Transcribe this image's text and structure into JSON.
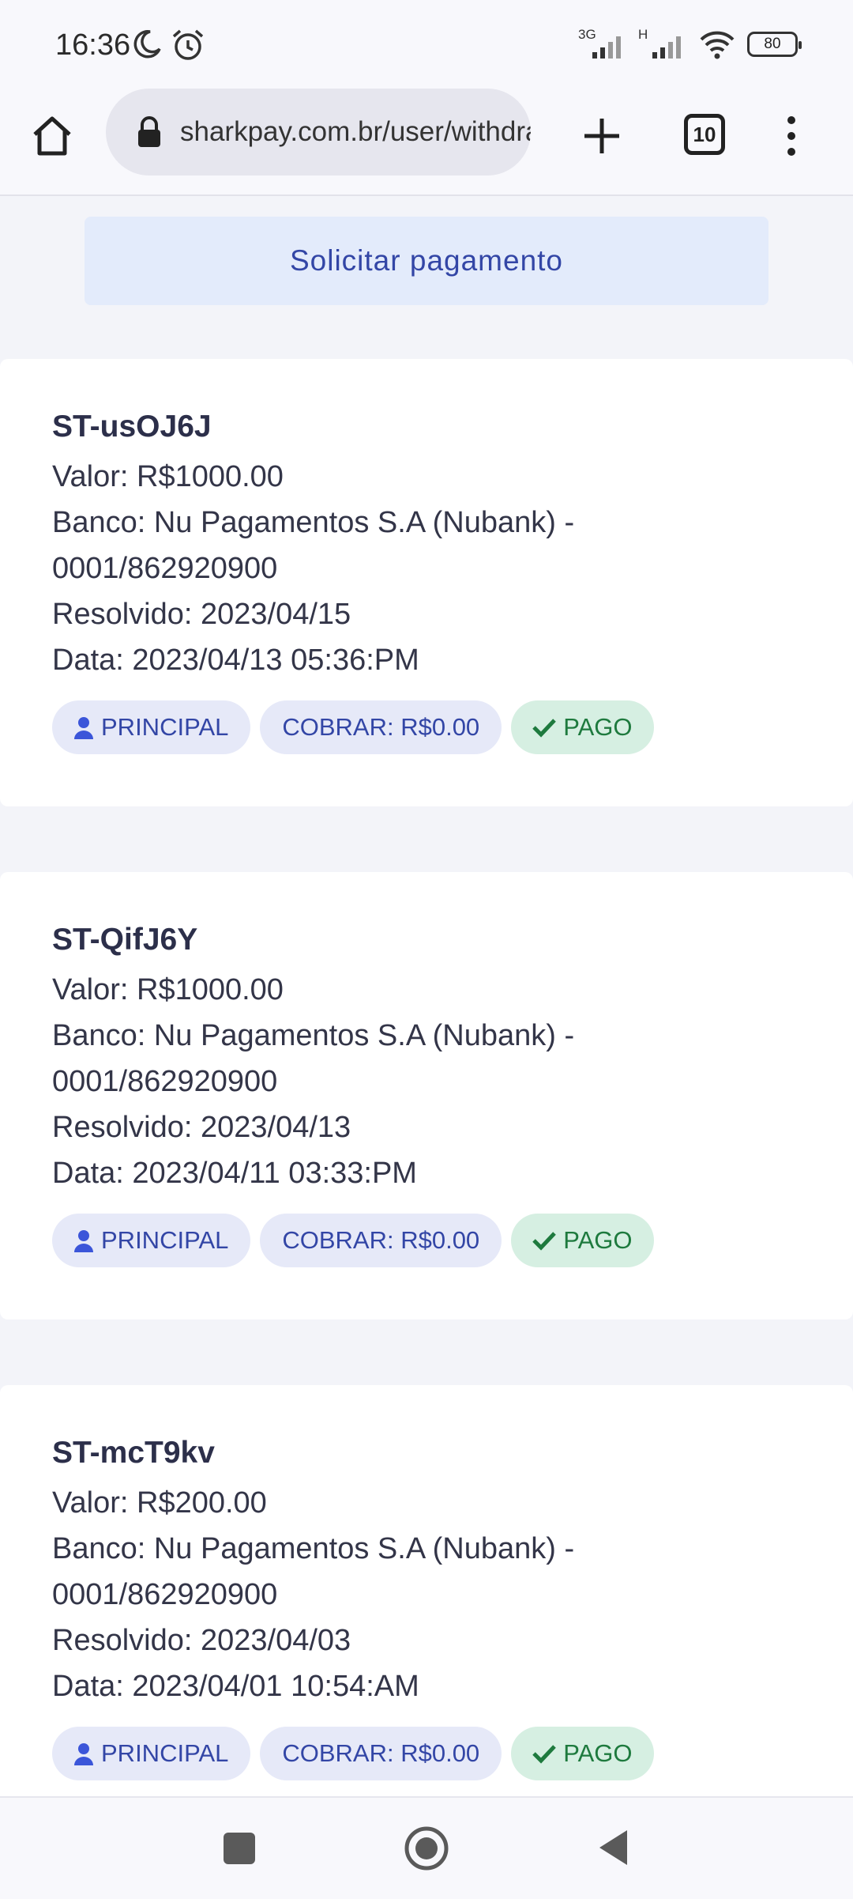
{
  "status_bar": {
    "time": "16:36",
    "network_1": "3G",
    "network_2": "H",
    "battery": "80"
  },
  "browser": {
    "url": "sharkpay.com.br/user/withdraw",
    "tab_count": "10"
  },
  "page": {
    "request_button": "Solicitar pagamento",
    "withdrawals": [
      {
        "id": "ST-usOJ6J",
        "valor": "Valor: R$1000.00",
        "banco_1": "Banco: Nu Pagamentos S.A (Nubank) -",
        "banco_2": "0001/862920900",
        "resolvido": "Resolvido: 2023/04/15",
        "data": "Data: 2023/04/13 05:36:PM",
        "chip_principal": "PRINCIPAL",
        "chip_cobrar": "COBRAR: R$0.00",
        "chip_status": "PAGO"
      },
      {
        "id": "ST-QifJ6Y",
        "valor": "Valor: R$1000.00",
        "banco_1": "Banco: Nu Pagamentos S.A (Nubank) -",
        "banco_2": "0001/862920900",
        "resolvido": "Resolvido: 2023/04/13",
        "data": "Data: 2023/04/11 03:33:PM",
        "chip_principal": "PRINCIPAL",
        "chip_cobrar": "COBRAR: R$0.00",
        "chip_status": "PAGO"
      },
      {
        "id": "ST-mcT9kv",
        "valor": "Valor: R$200.00",
        "banco_1": "Banco: Nu Pagamentos S.A (Nubank) -",
        "banco_2": "0001/862920900",
        "resolvido": "Resolvido: 2023/04/03",
        "data": "Data: 2023/04/01 10:54:AM",
        "chip_principal": "PRINCIPAL",
        "chip_cobrar": "COBRAR: R$0.00",
        "chip_status": "PAGO"
      }
    ]
  },
  "colors": {
    "accent": "#3346a6",
    "paid_green": "#1e7a3e",
    "chip_bg": "#e6e9f8",
    "paid_bg": "#d6efe2"
  }
}
